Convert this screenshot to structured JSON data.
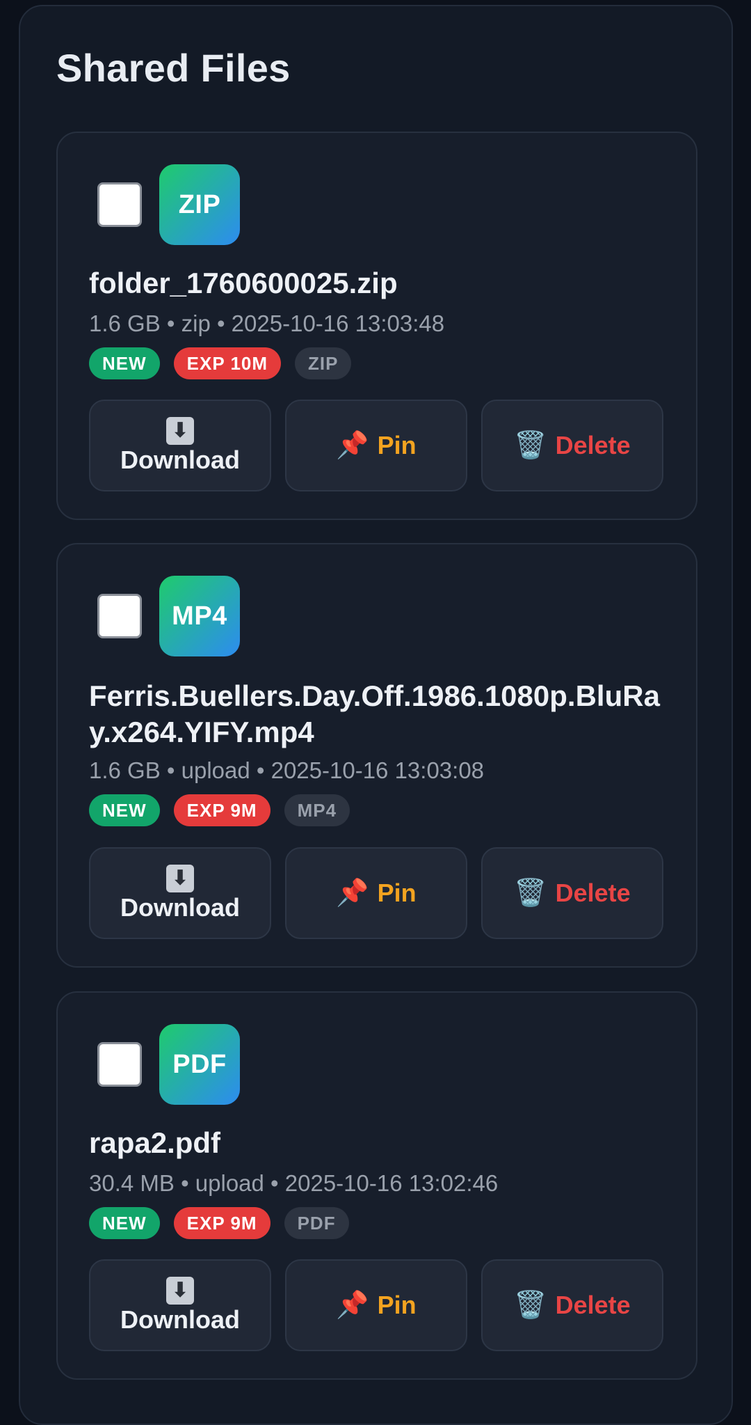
{
  "title": "Shared Files",
  "actions": {
    "download_label": "Download",
    "pin_label": "Pin",
    "delete_label": "Delete",
    "download_icon": "⬇",
    "pin_icon": "📌",
    "delete_icon": "🗑️"
  },
  "files": [
    {
      "icon_text": "ZIP",
      "name": "folder_1760600025.zip",
      "meta": "1.6 GB • zip • 2025-10-16 13:03:48",
      "badge_new": "NEW",
      "badge_exp": "EXP 10M",
      "badge_type": "ZIP"
    },
    {
      "icon_text": "MP4",
      "name": "Ferris.Buellers.Day.Off.1986.1080p.BluRay.x264.YIFY.mp4",
      "meta": "1.6 GB • upload • 2025-10-16 13:03:08",
      "badge_new": "NEW",
      "badge_exp": "EXP 9M",
      "badge_type": "MP4"
    },
    {
      "icon_text": "PDF",
      "name": "rapa2.pdf",
      "meta": "30.4 MB • upload • 2025-10-16 13:02:46",
      "badge_new": "NEW",
      "badge_exp": "EXP 9M",
      "badge_type": "PDF"
    }
  ],
  "colors": {
    "background": "#0c111b",
    "panel": "#131a26",
    "card": "#171e2b",
    "badge_new": "#12a56a",
    "badge_exp": "#e53b3b",
    "pin": "#f3a320",
    "delete": "#e84545"
  }
}
